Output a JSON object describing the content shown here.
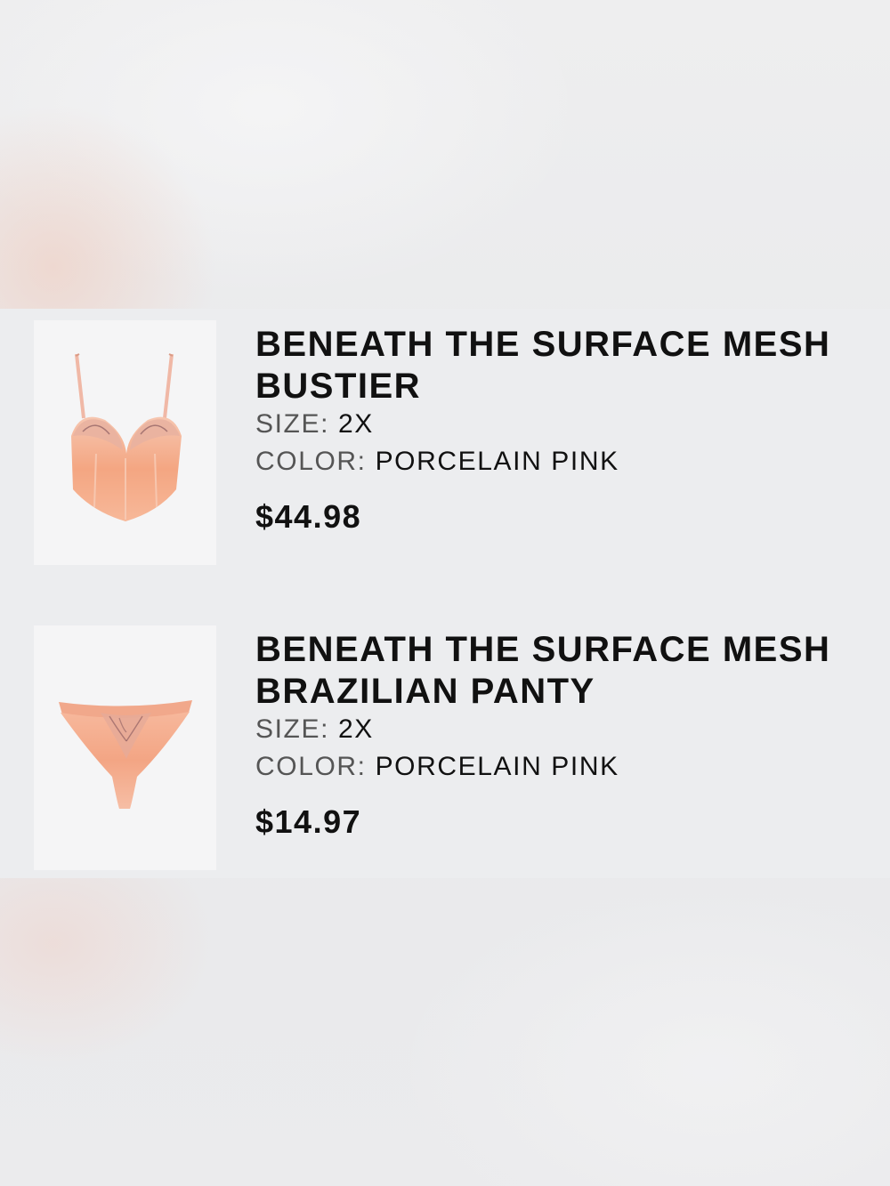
{
  "products": [
    {
      "title_line1": "BENEATH THE SURFACE MESH",
      "title_line2": "BUSTIER",
      "size_label": "SIZE:",
      "size_value": "2X",
      "color_label": "COLOR:",
      "color_value": "PORCELAIN PINK",
      "price": "$44.98",
      "image_icon": "bustier-product-image"
    },
    {
      "title_line1": "BENEATH THE SURFACE MESH",
      "title_line2": "BRAZILIAN PANTY",
      "size_label": "SIZE:",
      "size_value": "2X",
      "color_label": "COLOR:",
      "color_value": "PORCELAIN PINK",
      "price": "$14.97",
      "image_icon": "panty-product-image"
    }
  ],
  "colors": {
    "product_peach": "#f4a98a",
    "product_pink": "#f0b3a4"
  }
}
